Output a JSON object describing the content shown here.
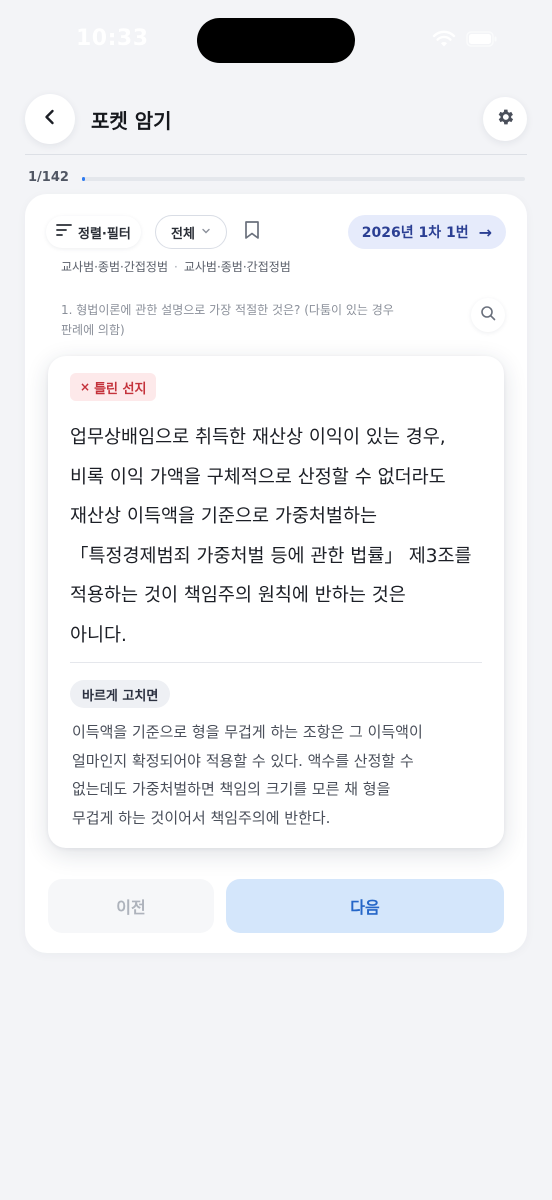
{
  "status_bar": {
    "time": "10:33"
  },
  "header": {
    "title": "포켓 암기"
  },
  "progress": {
    "label": "1/142",
    "current": 1,
    "total": 142
  },
  "toolbar": {
    "sort_filter_label": "정렬·필터",
    "filter_value": "전체",
    "exam_label": "2026년 1차 1번",
    "exam_arrow": "→"
  },
  "tags": [
    "교사범·종범·간접정범",
    "교사범·종범·간접정범"
  ],
  "tag_separator": "·",
  "question": {
    "line1": "1. 형법이론에 관한 설명으로 가장 적절한 것은? (다툼이 있는 경우",
    "line2": "판례에 의함)"
  },
  "answer": {
    "wrong_badge_mark": "×",
    "wrong_badge_label": "틀린 선지",
    "statement_lines": [
      "업무상배임으로 취득한 재산상 이익이 있는 경우,",
      "비록 이익 가액을 구체적으로 산정할 수 없더라도",
      "재산상 이득액을 기준으로 가중처벌하는",
      "「특정경제범죄 가중처벌 등에 관한 법률」 제3조를",
      "적용하는 것이 책임주의 원칙에 반하는 것은",
      "아니다."
    ],
    "correct_badge_label": "바르게 고치면",
    "correction_lines": [
      "이득액을 기준으로 형을 무겁게 하는 조항은 그 이득액이",
      "얼마인지 확정되어야 적용할 수 있다. 액수를 산정할 수",
      "없는데도 가중처벌하면 책임의 크기를 모른 채 형을",
      "무겁게 하는 것이어서 책임주의에 반한다."
    ]
  },
  "navigation": {
    "prev_label": "이전",
    "next_label": "다음"
  },
  "colors": {
    "accent": "#2e7bf0",
    "exam_chip_bg": "#e6ebfb",
    "exam_chip_text": "#2b3f93",
    "wrong_bg": "#fde9ea",
    "wrong_text": "#c4323b",
    "next_bg": "#d4e6fb",
    "next_text": "#2466c8"
  },
  "icons": {
    "back": "chevron-left-icon",
    "settings": "gear-icon",
    "sort": "sort-lines-icon",
    "dropdown": "chevron-down-icon",
    "bookmark": "bookmark-icon",
    "search": "search-icon",
    "wifi": "wifi-icon",
    "battery": "battery-icon"
  }
}
